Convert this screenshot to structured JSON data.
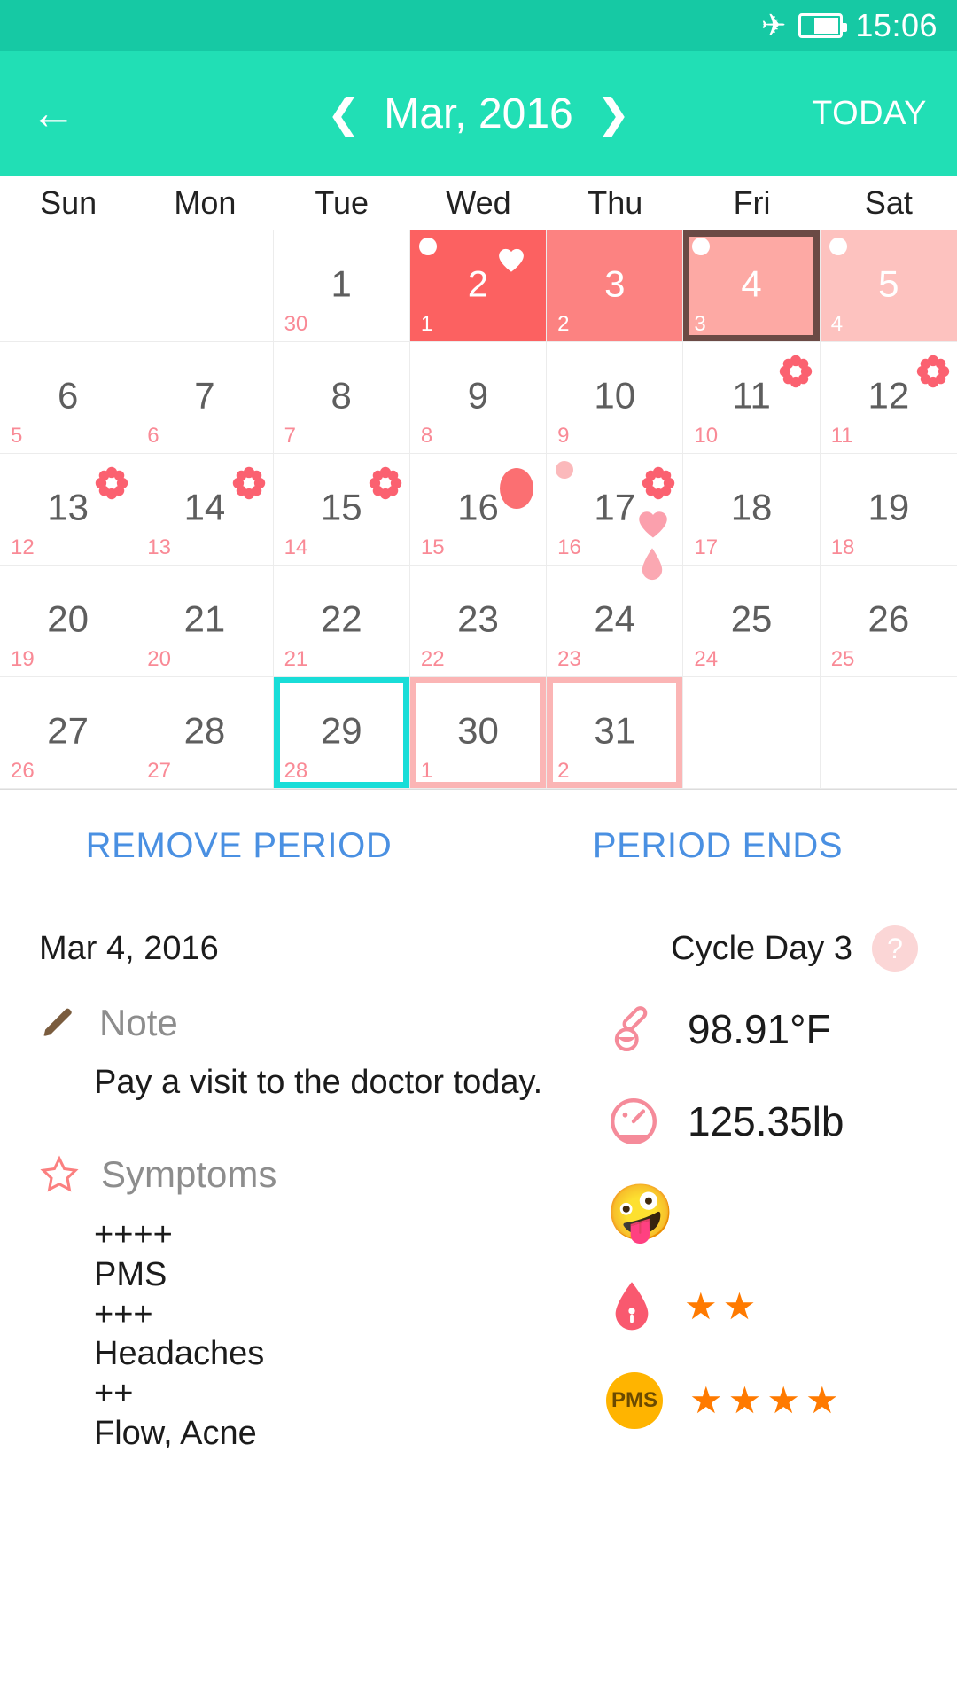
{
  "statusbar": {
    "time": "15:06",
    "airplane_icon": "airplane-icon",
    "battery_icon": "battery-icon"
  },
  "appbar": {
    "back_icon": "back-arrow-icon",
    "prev_icon": "chevron-left-icon",
    "month": "Mar, 2016",
    "next_icon": "chevron-right-icon",
    "today_label": "TODAY"
  },
  "weekdays": [
    "Sun",
    "Mon",
    "Tue",
    "Wed",
    "Thu",
    "Fri",
    "Sat"
  ],
  "calendar": {
    "weeks": [
      [
        {
          "day": "",
          "cycle": ""
        },
        {
          "day": "",
          "cycle": ""
        },
        {
          "day": "1",
          "cycle": "30"
        },
        {
          "day": "2",
          "cycle": "1",
          "fill": "p-heavy",
          "dot": true,
          "heart_white": true
        },
        {
          "day": "3",
          "cycle": "2",
          "fill": "p-med"
        },
        {
          "day": "4",
          "cycle": "3",
          "fill": "p-light",
          "dot": true,
          "selected": true
        },
        {
          "day": "5",
          "cycle": "4",
          "fill": "p-lightest",
          "dot": true
        }
      ],
      [
        {
          "day": "6",
          "cycle": "5"
        },
        {
          "day": "7",
          "cycle": "6"
        },
        {
          "day": "8",
          "cycle": "7"
        },
        {
          "day": "9",
          "cycle": "8"
        },
        {
          "day": "10",
          "cycle": "9"
        },
        {
          "day": "11",
          "cycle": "10",
          "flower": true
        },
        {
          "day": "12",
          "cycle": "11",
          "flower": true
        }
      ],
      [
        {
          "day": "13",
          "cycle": "12",
          "flower": true
        },
        {
          "day": "14",
          "cycle": "13",
          "flower": true
        },
        {
          "day": "15",
          "cycle": "14",
          "flower": true
        },
        {
          "day": "16",
          "cycle": "15",
          "ovulation": true
        },
        {
          "day": "17",
          "cycle": "16",
          "pinkdot": true,
          "flower": true,
          "heart_pink": true,
          "drop": true
        },
        {
          "day": "18",
          "cycle": "17"
        },
        {
          "day": "19",
          "cycle": "18"
        }
      ],
      [
        {
          "day": "20",
          "cycle": "19"
        },
        {
          "day": "21",
          "cycle": "20"
        },
        {
          "day": "22",
          "cycle": "21"
        },
        {
          "day": "23",
          "cycle": "22"
        },
        {
          "day": "24",
          "cycle": "23"
        },
        {
          "day": "25",
          "cycle": "24"
        },
        {
          "day": "26",
          "cycle": "25"
        }
      ],
      [
        {
          "day": "27",
          "cycle": "26"
        },
        {
          "day": "28",
          "cycle": "27"
        },
        {
          "day": "29",
          "cycle": "28",
          "cyan_box": true
        },
        {
          "day": "30",
          "cycle": "1",
          "pink_box": true
        },
        {
          "day": "31",
          "cycle": "2",
          "pink_box": true
        },
        {
          "day": "",
          "cycle": ""
        },
        {
          "day": "",
          "cycle": ""
        }
      ]
    ]
  },
  "actions": {
    "remove_period": "REMOVE PERIOD",
    "period_ends": "PERIOD ENDS"
  },
  "detail": {
    "date": "Mar 4, 2016",
    "cycle_day": "Cycle Day 3",
    "help_icon": "?",
    "note_icon": "pencil-icon",
    "note_label": "Note",
    "note_text": "Pay a visit to the doctor today.",
    "symptoms_icon": "star-icon",
    "symptoms_label": "Symptoms",
    "symptoms_lines": [
      "++++",
      "PMS",
      "+++",
      "Headaches",
      "++",
      "Flow, Acne"
    ],
    "temperature": {
      "icon": "thermometer-icon",
      "value": "98.91°F"
    },
    "weight": {
      "icon": "scale-icon",
      "value": "125.35lb"
    },
    "mood": {
      "icon": "mood-emoji",
      "emoji": "🤪"
    },
    "flow": {
      "icon": "blood-drop-icon",
      "stars": 2
    },
    "pms": {
      "icon": "pms-icon",
      "label": "PMS",
      "stars": 4
    }
  },
  "colors": {
    "accent_teal": "#21dfb5",
    "status_teal": "#16c9a4",
    "period_heavy": "#fc6161",
    "period_med": "#fc8281",
    "period_light": "#fda9a4",
    "period_lightest": "#fdc2bf",
    "link_blue": "#4a90e2",
    "cycle_pink": "#f98a96",
    "star_orange": "#ff7a00",
    "selected_outline": "#6b4a45",
    "cyan_outline": "#19ddd8",
    "pink_outline": "#fbb5b5"
  }
}
